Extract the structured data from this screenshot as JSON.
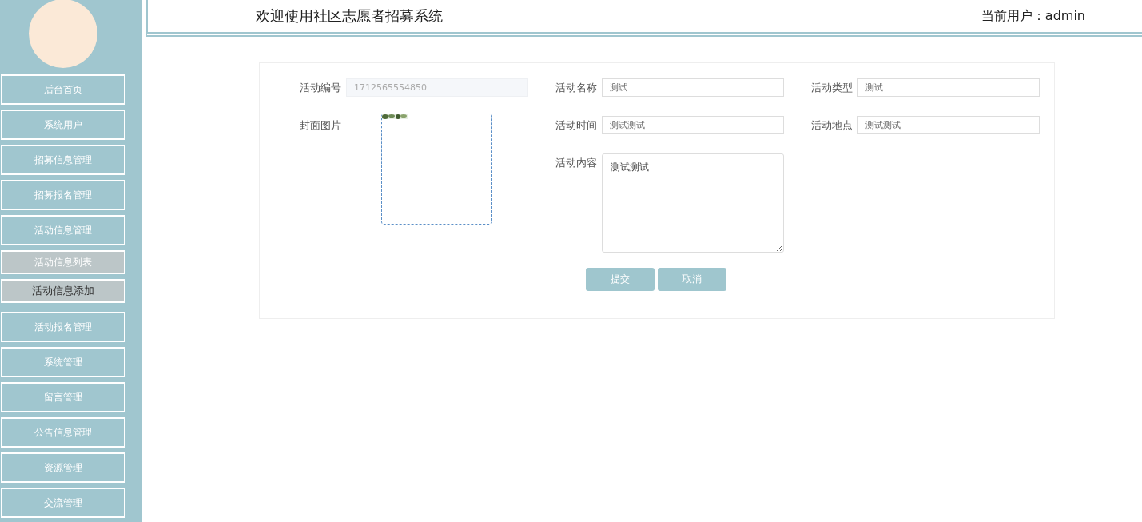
{
  "header": {
    "title": "欢迎使用社区志愿者招募系统",
    "user_label": "当前用户：admin"
  },
  "sidebar": {
    "items": [
      {
        "label": "后台首页",
        "kind": "menu",
        "selected": false
      },
      {
        "label": "系统用户",
        "kind": "menu",
        "selected": false
      },
      {
        "label": "招募信息管理",
        "kind": "menu",
        "selected": false
      },
      {
        "label": "招募报名管理",
        "kind": "menu",
        "selected": false
      },
      {
        "label": "活动信息管理",
        "kind": "menu",
        "selected": false
      },
      {
        "label": "活动信息列表",
        "kind": "submenu",
        "selected": false
      },
      {
        "label": "活动信息添加",
        "kind": "submenu",
        "selected": true
      },
      {
        "label": "活动报名管理",
        "kind": "menu",
        "selected": false
      },
      {
        "label": "系统管理",
        "kind": "menu",
        "selected": false
      },
      {
        "label": "留言管理",
        "kind": "menu",
        "selected": false
      },
      {
        "label": "公告信息管理",
        "kind": "menu",
        "selected": false
      },
      {
        "label": "资源管理",
        "kind": "menu",
        "selected": false
      },
      {
        "label": "交流管理",
        "kind": "menu",
        "selected": false
      }
    ]
  },
  "form": {
    "fields": [
      {
        "label": "活动编号",
        "kind": "readonly",
        "value": "1712565554850"
      },
      {
        "label": "活动名称",
        "kind": "text",
        "value": "测试"
      },
      {
        "label": "活动类型",
        "kind": "text",
        "value": "测试"
      },
      {
        "label": "封面图片"
      },
      {
        "label": "活动时间",
        "kind": "text",
        "value": "测试测试"
      },
      {
        "label": "活动地点",
        "kind": "text",
        "value": "测试测试"
      },
      {
        "label": "活动内容",
        "kind": "textarea",
        "value": "测试测试"
      }
    ],
    "buttons": [
      "提交",
      "取消"
    ]
  }
}
